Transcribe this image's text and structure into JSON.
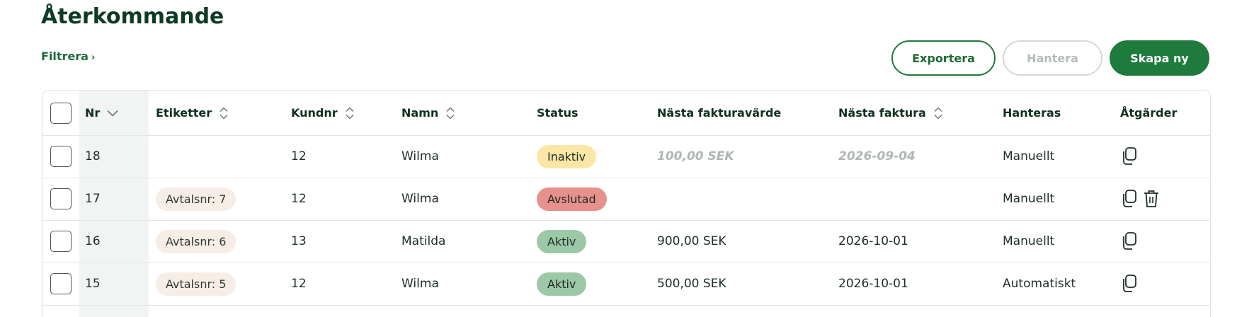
{
  "page": {
    "title": "Återkommande",
    "filter_label": "Filtrera",
    "filter_chevron": "›"
  },
  "toolbar": {
    "export_label": "Exportera",
    "manage_label": "Hantera",
    "create_label": "Skapa ny"
  },
  "icons": {
    "sort_down": "chevron-down-icon",
    "sort_both": "sort-icon",
    "copy": "copy-icon",
    "delete": "trash-icon"
  },
  "colors": {
    "brand": "#1f7a3e",
    "title": "#0e3b26",
    "status_inaktiv": "#fbe6a6",
    "status_avslutad": "#e7918c",
    "status_aktiv": "#9cc8a6",
    "tag_bg": "#f7ede7"
  },
  "table": {
    "headers": {
      "nr": "Nr",
      "etiketter": "Etiketter",
      "kundnr": "Kundnr",
      "namn": "Namn",
      "status": "Status",
      "nasta_fakturavarde": "Nästa fakturavärde",
      "nasta_faktura": "Nästa faktura",
      "hanteras": "Hanteras",
      "atgarder": "Åtgärder"
    },
    "rows": [
      {
        "nr": "18",
        "etikett": "",
        "kundnr": "12",
        "namn": "Wilma",
        "status": "Inaktiv",
        "fakturavarde": "100,00 SEK",
        "nasta_faktura": "2026-09-04",
        "hanteras": "Manuellt"
      },
      {
        "nr": "17",
        "etikett": "Avtalsnr: 7",
        "kundnr": "12",
        "namn": "Wilma",
        "status": "Avslutad",
        "fakturavarde": "",
        "nasta_faktura": "",
        "hanteras": "Manuellt"
      },
      {
        "nr": "16",
        "etikett": "Avtalsnr: 6",
        "kundnr": "13",
        "namn": "Matilda",
        "status": "Aktiv",
        "fakturavarde": "900,00 SEK",
        "nasta_faktura": "2026-10-01",
        "hanteras": "Manuellt"
      },
      {
        "nr": "15",
        "etikett": "Avtalsnr: 5",
        "kundnr": "12",
        "namn": "Wilma",
        "status": "Aktiv",
        "fakturavarde": "500,00 SEK",
        "nasta_faktura": "2026-10-01",
        "hanteras": "Automatiskt"
      }
    ]
  }
}
